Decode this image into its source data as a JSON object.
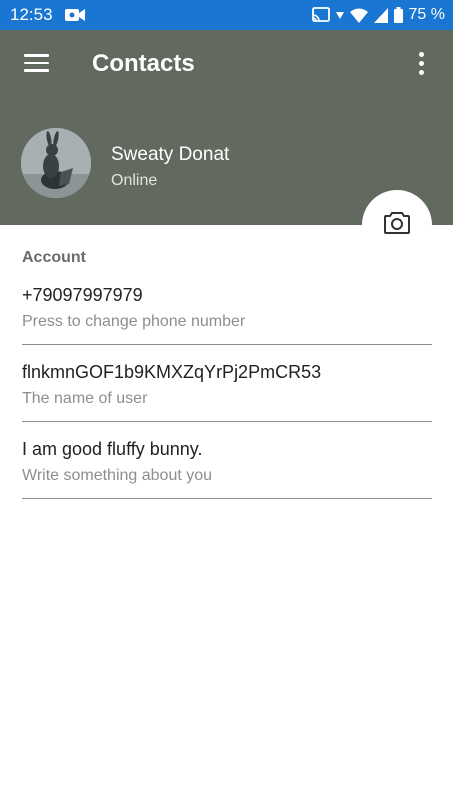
{
  "status_bar": {
    "time": "12:53",
    "battery": "75 %"
  },
  "toolbar": {
    "title": "Contacts"
  },
  "profile": {
    "name": "Sweaty Donat",
    "status": "Online"
  },
  "account": {
    "section_title": "Account",
    "fields": [
      {
        "value": "+79097997979",
        "hint": "Press to change phone number"
      },
      {
        "value": "flnkmnGOF1b9KMXZqYrPj2PmCR53",
        "hint": "The name of user"
      },
      {
        "value": "I am good fluffy bunny.",
        "hint": "Write something about you"
      }
    ]
  },
  "colors": {
    "status_bar": "#1976d2",
    "header": "#626a60"
  },
  "icons": [
    "video-icon",
    "cast-icon",
    "wifi-icon",
    "signal-icon",
    "battery-icon",
    "menu-icon",
    "more-vert-icon",
    "camera-icon"
  ]
}
